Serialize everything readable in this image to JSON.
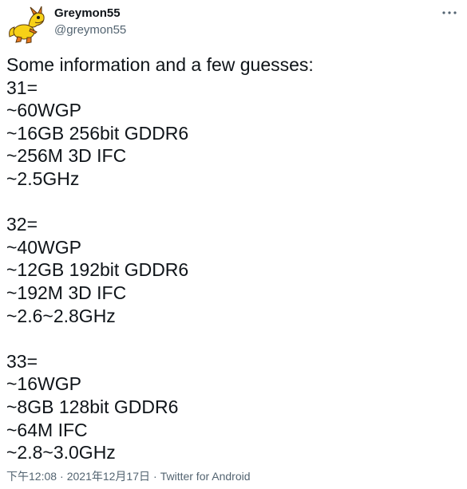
{
  "author": {
    "display_name": "Greymon55",
    "handle": "@greymon55",
    "avatar_icon": "yellow-cartoon-dragon-avatar-icon"
  },
  "more_icon": "more-dots-icon",
  "tweet_lines": [
    "Some information and a few guesses:",
    "31=",
    "~60WGP",
    "~16GB 256bit GDDR6",
    "~256M 3D IFC",
    "~2.5GHz",
    "",
    "32=",
    "~40WGP",
    "~12GB 192bit GDDR6",
    "~192M 3D IFC",
    "~2.6~2.8GHz",
    "",
    "33=",
    "~16WGP",
    "~8GB 128bit GDDR6",
    "~64M IFC",
    "~2.8~3.0GHz"
  ],
  "meta": {
    "time": "下午12:08",
    "separator": "·",
    "date": "2021年12月17日",
    "source": "Twitter for Android"
  },
  "colors": {
    "text": "#0f1419",
    "secondary": "#536471",
    "avatar_yellow": "#f7d117",
    "avatar_orange": "#e8771e"
  }
}
